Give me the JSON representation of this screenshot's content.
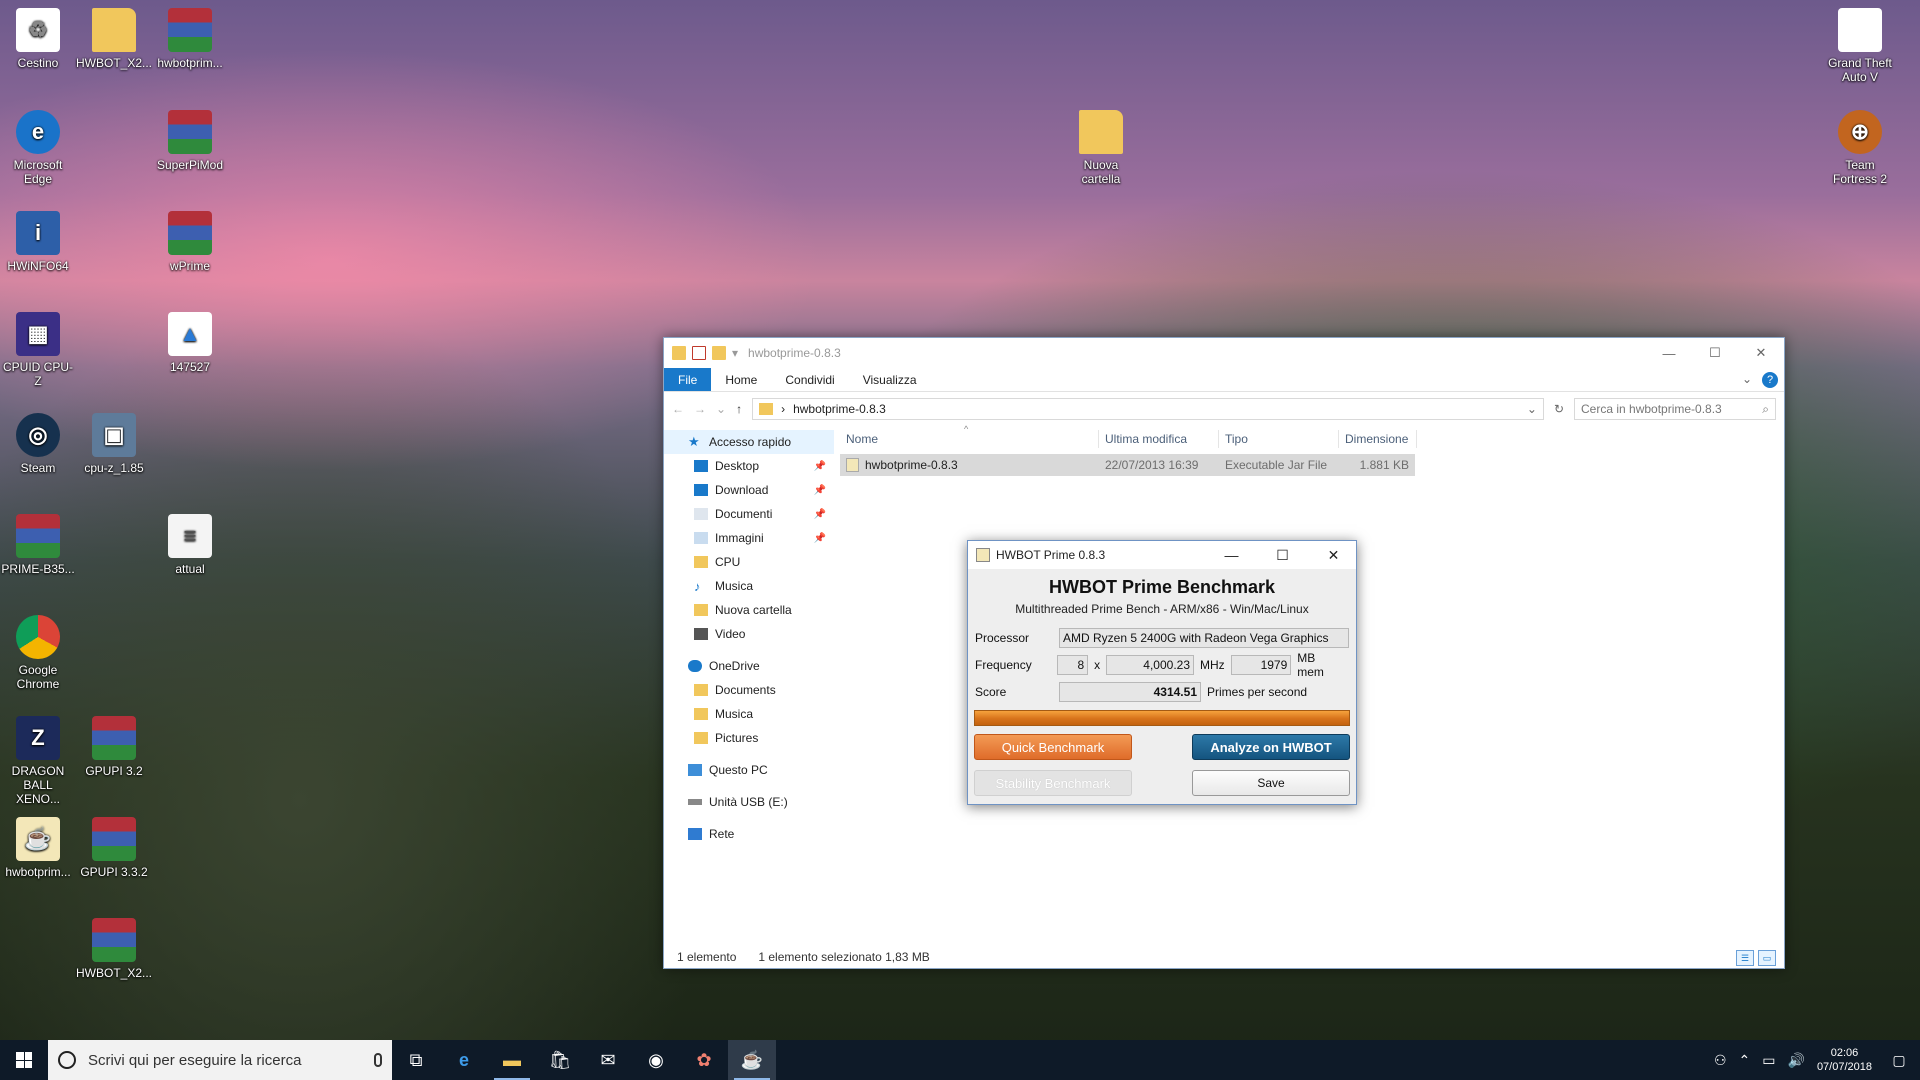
{
  "desktop": {
    "icons": [
      {
        "label": "Cestino",
        "icon": "recycle-bin-icon",
        "glyph": "♻"
      },
      {
        "label": "HWBOT_X2...",
        "icon": "folder-icon",
        "glyph": ""
      },
      {
        "label": "hwbotprim...",
        "icon": "winrar-icon",
        "glyph": ""
      },
      {
        "label": "Microsoft Edge",
        "icon": "edge-icon",
        "glyph": "e"
      },
      {
        "label": "SuperPiMod",
        "icon": "winrar-icon",
        "glyph": ""
      },
      {
        "label": "HWiNFO64",
        "icon": "hwinfo-icon",
        "glyph": "i"
      },
      {
        "label": "wPrime",
        "icon": "winrar-icon",
        "glyph": ""
      },
      {
        "label": "CPUID CPU-Z",
        "icon": "cpuz-icon",
        "glyph": "▦"
      },
      {
        "label": "147527",
        "icon": "image-file-icon",
        "glyph": "▲"
      },
      {
        "label": "Steam",
        "icon": "steam-icon",
        "glyph": "◎"
      },
      {
        "label": "cpu-z_1.85",
        "icon": "cpuz-installer-icon",
        "glyph": "▣"
      },
      {
        "label": "PRIME-B35...",
        "icon": "winrar-icon",
        "glyph": ""
      },
      {
        "label": "attual",
        "icon": "document-icon",
        "glyph": "≡"
      },
      {
        "label": "Google Chrome",
        "icon": "chrome-icon",
        "glyph": ""
      },
      {
        "label": "DRAGON BALL XENO...",
        "icon": "dragonball-icon",
        "glyph": "Z"
      },
      {
        "label": "GPUPI 3.2",
        "icon": "winrar-icon",
        "glyph": ""
      },
      {
        "label": "hwbotprim...",
        "icon": "jar-file-icon",
        "glyph": "☕"
      },
      {
        "label": "GPUPI 3.3.2",
        "icon": "winrar-icon",
        "glyph": ""
      },
      {
        "label": "HWBOT_X2...",
        "icon": "winrar-icon",
        "glyph": ""
      },
      {
        "label": "Nuova cartella",
        "icon": "folder-icon",
        "glyph": ""
      },
      {
        "label": "Grand Theft Auto V",
        "icon": "file-icon",
        "glyph": ""
      },
      {
        "label": "Team Fortress 2",
        "icon": "tf2-icon",
        "glyph": "⊕"
      }
    ]
  },
  "explorer": {
    "title": "hwbotprime-0.8.3",
    "window_controls": {
      "minimize": "—",
      "maximize": "☐",
      "close": "✕"
    },
    "ribbon_tabs": [
      "File",
      "Home",
      "Condividi",
      "Visualizza"
    ],
    "address_path": "hwbotprime-0.8.3",
    "path_separator": "›",
    "search_placeholder": "Cerca in hwbotprime-0.8.3",
    "nav": {
      "quick_access": "Accesso rapido",
      "quick_items": [
        {
          "label": "Desktop",
          "pinned": true,
          "icon": "desktop-icon"
        },
        {
          "label": "Download",
          "pinned": true,
          "icon": "download-icon"
        },
        {
          "label": "Documenti",
          "pinned": true,
          "icon": "documents-icon"
        },
        {
          "label": "Immagini",
          "pinned": true,
          "icon": "pictures-icon"
        },
        {
          "label": "CPU",
          "pinned": false,
          "icon": "folder-icon"
        },
        {
          "label": "Musica",
          "pinned": false,
          "icon": "music-icon"
        },
        {
          "label": "Nuova cartella",
          "pinned": false,
          "icon": "folder-icon"
        },
        {
          "label": "Video",
          "pinned": false,
          "icon": "video-icon"
        }
      ],
      "onedrive": "OneDrive",
      "onedrive_items": [
        "Documents",
        "Musica",
        "Pictures"
      ],
      "this_pc": "Questo PC",
      "usb": "Unità USB (E:)",
      "network": "Rete"
    },
    "columns": [
      "Nome",
      "Ultima modifica",
      "Tipo",
      "Dimensione"
    ],
    "files": [
      {
        "name": "hwbotprime-0.8.3",
        "modified": "22/07/2013 16:39",
        "type": "Executable Jar File",
        "size": "1.881 KB"
      }
    ],
    "status": {
      "count": "1 elemento",
      "selected": "1 elemento selezionato 1,83 MB"
    }
  },
  "hwbot": {
    "title": "HWBOT Prime 0.8.3",
    "heading": "HWBOT Prime Benchmark",
    "subheading": "Multithreaded Prime Bench - ARM/x86 - Win/Mac/Linux",
    "processor_label": "Processor",
    "processor_value": "AMD Ryzen 5 2400G with Radeon Vega Graphics",
    "frequency_label": "Frequency",
    "threads": "8",
    "times": "x",
    "frequency": "4,000.23",
    "mhz": "MHz",
    "mem": "1979",
    "mem_unit": "MB mem",
    "score_label": "Score",
    "score": "4314.51",
    "score_unit": "Primes per second",
    "progress": 1.0,
    "buttons": {
      "quick": "Quick Benchmark",
      "analyze": "Analyze on HWBOT",
      "stability": "Stability Benchmark",
      "save": "Save"
    }
  },
  "taskbar": {
    "search_placeholder": "Scrivi qui per eseguire la ricerca",
    "time": "02:06",
    "date": "07/07/2018"
  },
  "colors": {
    "accent": "#1979ca",
    "hwbot_orange": "#df6c2a",
    "hwbot_blue": "#14547f",
    "taskbar": "#0e1a28"
  }
}
